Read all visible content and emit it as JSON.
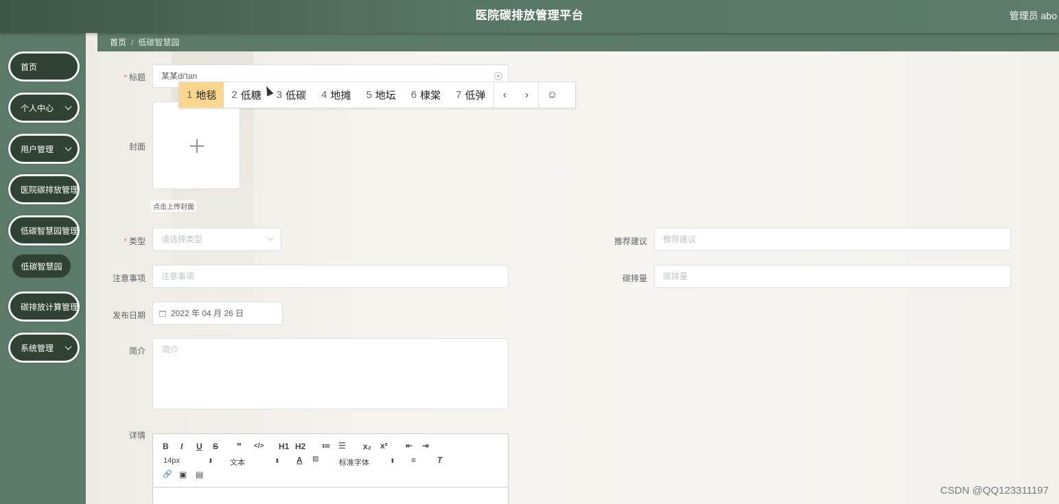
{
  "header": {
    "title": "医院碳排放管理平台",
    "user": "管理员 abo"
  },
  "sidebar": {
    "items": [
      {
        "label": "首页",
        "has_arrow": false
      },
      {
        "label": "个人中心",
        "has_arrow": true
      },
      {
        "label": "用户管理",
        "has_arrow": true
      },
      {
        "label": "医院碳排放管理",
        "has_arrow": false
      },
      {
        "label": "低碳智慧园管理",
        "has_arrow": false
      },
      {
        "label": "碳排放计算管理",
        "has_arrow": false
      },
      {
        "label": "系统管理",
        "has_arrow": true
      }
    ],
    "sub_active": "低碳智慧园"
  },
  "breadcrumb": {
    "home": "首页",
    "separator": "/",
    "current": "低碳智慧园"
  },
  "form": {
    "title": {
      "label": "标题",
      "value": "某某di'tan"
    },
    "cover": {
      "label": "封面",
      "tip": "点击上传封面"
    },
    "type": {
      "label": "类型",
      "placeholder": "请选择类型"
    },
    "suggestion": {
      "label": "推荐建议",
      "placeholder": "推荐建议"
    },
    "notes": {
      "label": "注意事项",
      "placeholder": "注意事项"
    },
    "emission": {
      "label": "碳排量",
      "placeholder": "碳排量"
    },
    "publish_date": {
      "label": "发布日期",
      "value": "2022 年 04 月 26 日"
    },
    "intro": {
      "label": "简介",
      "placeholder": "简介"
    },
    "detail": {
      "label": "详情"
    }
  },
  "editor": {
    "row1": [
      "B",
      "I",
      "U",
      "S",
      "❞",
      "</>",
      "H1",
      "H2",
      "≔",
      "☰",
      "x₂",
      "x²",
      "⇤",
      "⇥"
    ],
    "font_size": "14px",
    "block_type": "文本",
    "font_family": "标准字体",
    "row3": [
      "🔗",
      "▣",
      "▤"
    ]
  },
  "ime": {
    "candidates": [
      {
        "num": "1",
        "text": "地毯",
        "active": true
      },
      {
        "num": "2",
        "text": "低糖",
        "active": false
      },
      {
        "num": "3",
        "text": "低碳",
        "active": false
      },
      {
        "num": "4",
        "text": "地摊",
        "active": false
      },
      {
        "num": "5",
        "text": "地坛",
        "active": false
      },
      {
        "num": "6",
        "text": "棣棠",
        "active": false
      },
      {
        "num": "7",
        "text": "低弹",
        "active": false
      }
    ],
    "prev": "‹",
    "next": "›",
    "emoji": "☺"
  },
  "watermark": "CSDN @QQ123311197"
}
